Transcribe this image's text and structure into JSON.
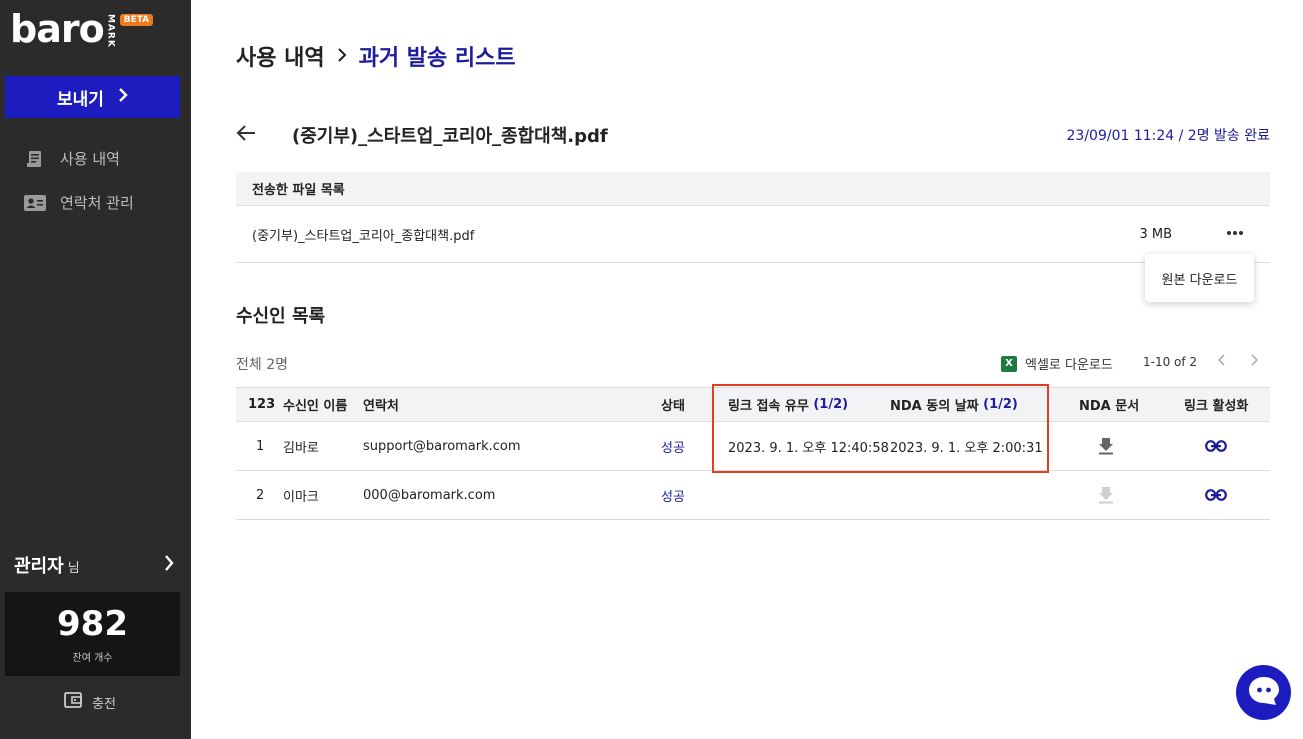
{
  "sidebar": {
    "logo_text": "baro",
    "logo_mark": "MARK",
    "logo_badge": "BETA",
    "send_label": "보내기",
    "nav": [
      {
        "label": "사용 내역",
        "icon": "document-icon"
      },
      {
        "label": "연락처 관리",
        "icon": "contact-card-icon"
      }
    ],
    "admin_name": "관리자",
    "admin_suffix": "님",
    "remaining_count": "982",
    "remaining_label": "잔여 개수",
    "charge_label": "충전"
  },
  "breadcrumb": {
    "parent": "사용 내역",
    "current": "과거 발송 리스트"
  },
  "file_header": {
    "title": "(중기부)_스타트업_코리아_종합대책.pdf",
    "status": "23/09/01 11:24 / 2명 발송 완료"
  },
  "files_table": {
    "header": "전송한 파일 목록",
    "rows": [
      {
        "name": "(중기부)_스타트업_코리아_종합대책.pdf",
        "size": "3 MB"
      }
    ],
    "menu_item": "원본 다운로드"
  },
  "recipients": {
    "title": "수신인 목록",
    "total": "전체 2명",
    "excel_label": "엑셀로 다운로드",
    "excel_icon": "X",
    "pagination": "1-10 of 2",
    "columns": {
      "num": "123",
      "name": "수신인 이름",
      "contact": "연락처",
      "status": "상태",
      "link_access": "링크 접속 유무",
      "link_access_count": "(1/2)",
      "nda_date": "NDA 동의 날짜",
      "nda_date_count": "(1/2)",
      "nda_doc": "NDA 문서",
      "link_active": "링크 활성화"
    },
    "rows": [
      {
        "num": "1",
        "name": "김바로",
        "contact": "support@baromark.com",
        "status": "성공",
        "link_access": "2023. 9. 1. 오후 12:40:58",
        "nda_date": "2023. 9. 1. 오후 2:00:31"
      },
      {
        "num": "2",
        "name": "이마크",
        "contact": "000@baromark.com",
        "status": "성공",
        "link_access": "",
        "nda_date": ""
      }
    ]
  },
  "colors": {
    "brand": "#1d1dbf",
    "accent_text": "#1d1d9b",
    "highlight": "#e0401f",
    "sidebar_bg": "#2b2b2b"
  }
}
